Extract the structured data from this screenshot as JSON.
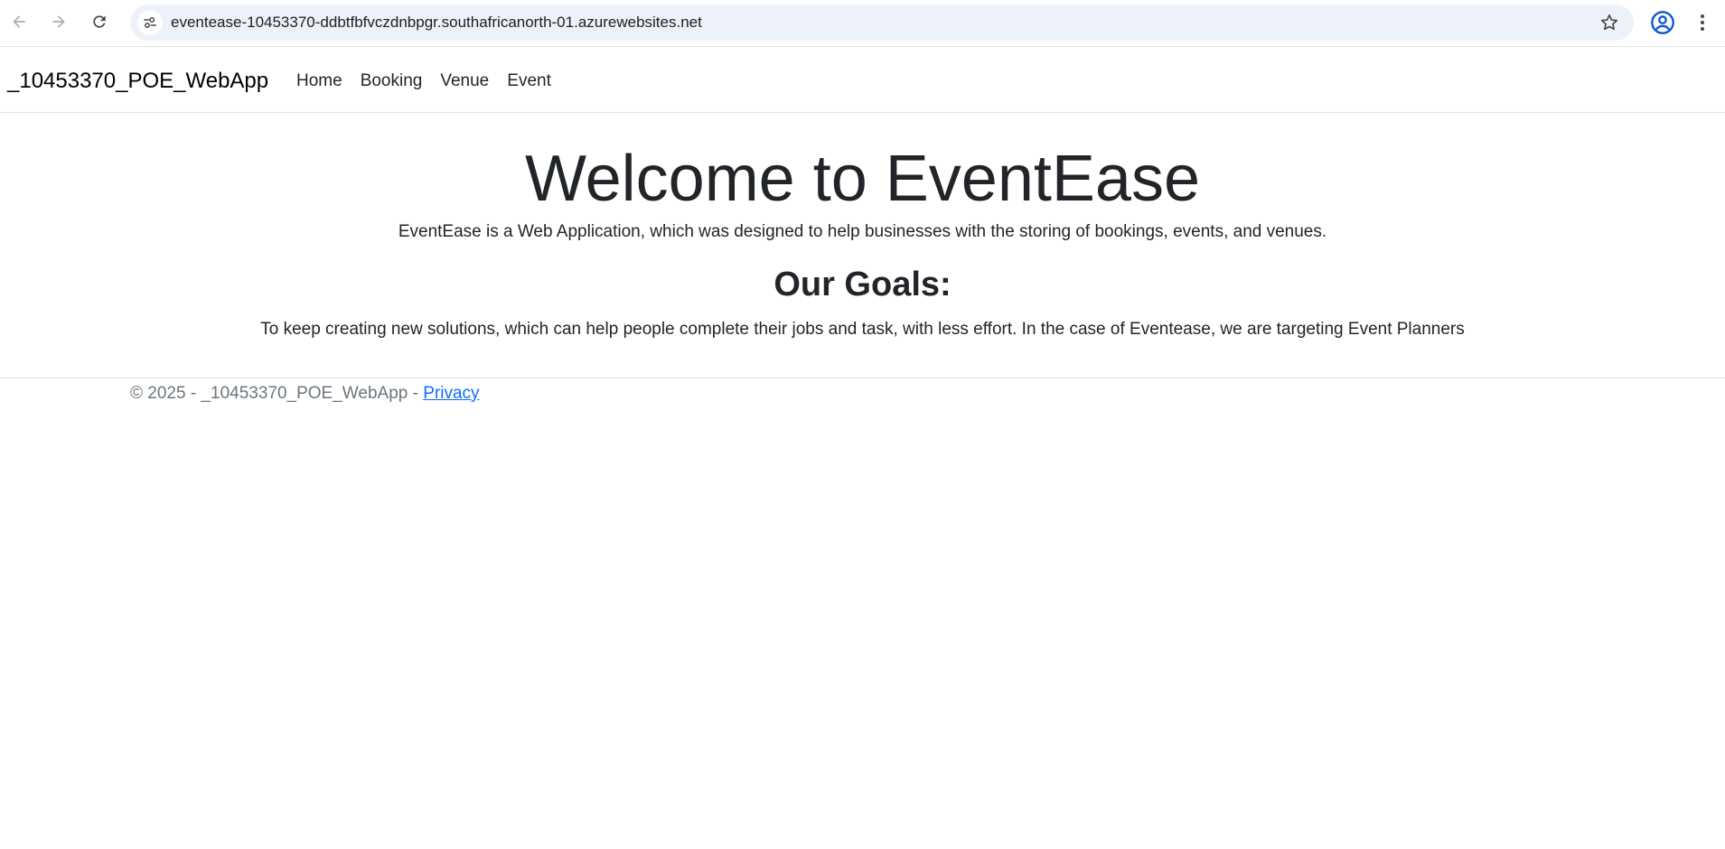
{
  "browser": {
    "url": "eventease-10453370-ddbtfbfvczdnbpgr.southafricanorth-01.azurewebsites.net",
    "icons": [
      "back-icon",
      "forward-icon",
      "reload-icon",
      "site-settings-icon",
      "bookmark-star-icon",
      "profile-icon",
      "menu-kebab-icon"
    ]
  },
  "navbar": {
    "brand": "_10453370_POE_WebApp",
    "links": [
      {
        "label": "Home"
      },
      {
        "label": "Booking"
      },
      {
        "label": "Venue"
      },
      {
        "label": "Event"
      }
    ]
  },
  "main": {
    "title": "Welcome to EventEase",
    "lead": "EventEase is a Web Application, which was designed to help businesses with the storing of bookings, events, and venues.",
    "goals_heading": "Our Goals:",
    "goals_text": "To keep creating new solutions, which can help people complete their jobs and task, with less effort. In the case of Eventease, we are targeting Event Planners"
  },
  "footer": {
    "text": "© 2025 - _10453370_POE_WebApp - ",
    "link": "Privacy"
  },
  "colors": {
    "link": "#0d6efd",
    "text": "#212529",
    "muted": "#6c757d",
    "omnibox": "#edf2fa",
    "profile": "#0b57d0"
  }
}
